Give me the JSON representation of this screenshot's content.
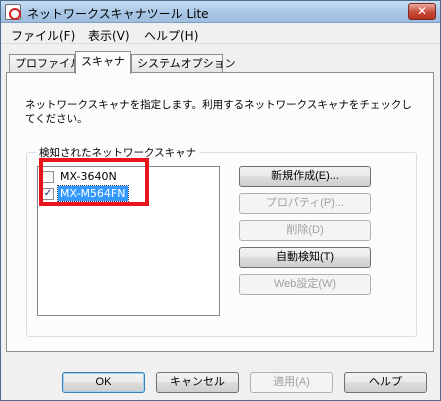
{
  "window": {
    "title": "ネットワークスキャナツール Lite",
    "close_glyph": "✕"
  },
  "menu": [
    {
      "label": "ファイル(F)"
    },
    {
      "label": "表示(V)"
    },
    {
      "label": "ヘルプ(H)"
    }
  ],
  "tabs": [
    {
      "label": "プロファイル",
      "active": false
    },
    {
      "label": "スキャナ",
      "active": true
    },
    {
      "label": "システムオプション",
      "active": false
    }
  ],
  "scanner_tab": {
    "instructions": "ネットワークスキャナを指定します。利用するネットワークスキャナをチェックしてください。",
    "group_label": "検知されたネットワークスキャナ",
    "scanners": [
      {
        "name": "MX-3640N",
        "checked": false,
        "check_glyph": "",
        "selected": false
      },
      {
        "name": "MX-M564FN",
        "checked": true,
        "check_glyph": "✓",
        "selected": true
      }
    ],
    "buttons": {
      "new": "新規作成(E)...",
      "properties": "プロパティ(P)...",
      "delete": "削除(D)",
      "auto_detect": "自動検知(T)",
      "web_settings": "Web設定(W)"
    }
  },
  "dialog_buttons": {
    "ok": "OK",
    "cancel": "キャンセル",
    "apply": "適用(A)",
    "help": "ヘルプ"
  },
  "colors": {
    "selection": "#3399ff",
    "highlight_frame": "#e8151c"
  }
}
